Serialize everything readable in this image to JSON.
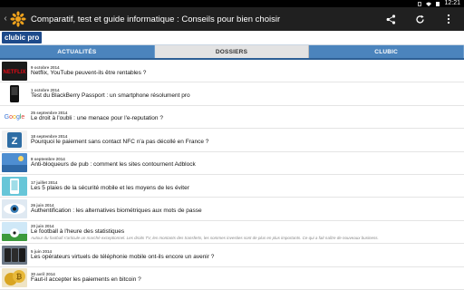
{
  "status_bar": {
    "time": "12:21"
  },
  "action_bar": {
    "back_icon": "chevron-left-icon",
    "app_icon": "clubic-sun-icon",
    "title": "Comparatif, test et guide informatique : Conseils pour bien choisir",
    "share_icon": "share-icon",
    "refresh_icon": "refresh-icon",
    "menu_icon": "overflow-menu-icon"
  },
  "brand": {
    "logo_text": "clubic pro"
  },
  "tabs": [
    {
      "label": "ACTUALITÉS"
    },
    {
      "label": "DOSSIERS"
    },
    {
      "label": "CLUBIC"
    }
  ],
  "articles": [
    {
      "date": "9 octobre 2014",
      "title": "Netflix, YouTube peuvent-ils être rentables ?",
      "thumb": "netflix"
    },
    {
      "date": "1 octobre 2014",
      "title": "Test du BlackBerry Passport : un smartphone résolument pro",
      "thumb": "blackberry"
    },
    {
      "date": "25 septembre 2014",
      "title": "Le droit à l'oubli : une menace pour l'e-reputation ?",
      "thumb": "google"
    },
    {
      "date": "18 septembre 2014",
      "title": "Pourquoi le paiement sans contact NFC n'a pas décollé en France ?",
      "thumb": "nfc"
    },
    {
      "date": "8 septembre 2014",
      "title": "Anti-bloqueurs de pub : comment les sites contournent Adblock",
      "thumb": "adblock"
    },
    {
      "date": "17 juillet 2014",
      "title": "Les 5 plaies de la sécurité mobile et les moyens de les éviter",
      "thumb": "mobile"
    },
    {
      "date": "26 juin 2014",
      "title": "Authentification : les alternatives biométriques aux mots de passe",
      "thumb": "eye"
    },
    {
      "date": "20 juin 2014",
      "title": "Le football à l'heure des statistiques",
      "excerpt": "Autour du football s'articule un marché exceptionnel. Les droits TV, les montants des transferts, les sommes investies sont de plus en plus importants. Ce qui a fait naître de nouveaux business.",
      "thumb": "football"
    },
    {
      "date": "5 juin 2014",
      "title": "Les opérateurs virtuels de téléphonie mobile ont-ils encore un avenir ?",
      "thumb": "phones"
    },
    {
      "date": "30 avril 2014",
      "title": "Faut-il accepter les paiements en bitcoin ?",
      "thumb": "bitcoin"
    }
  ]
}
